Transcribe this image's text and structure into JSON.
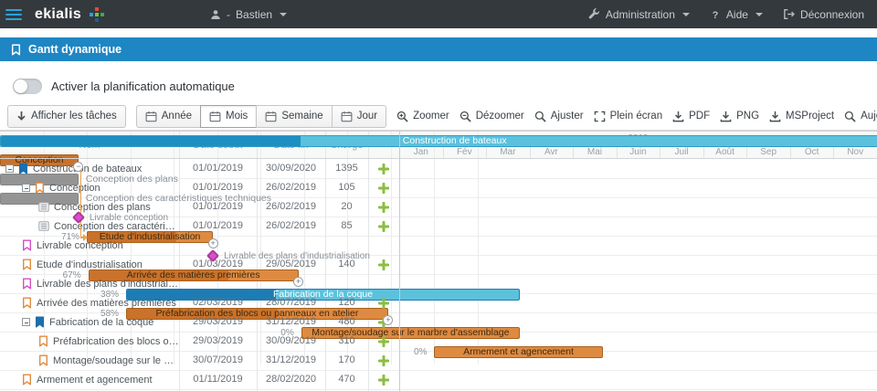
{
  "topbar": {
    "brand": "ekialis",
    "user_separator": "-",
    "user": "Bastien",
    "admin_label": "Administration",
    "help_label": "Aide",
    "logout_label": "Déconnexion"
  },
  "pageheader": {
    "title": "Gantt dynamique"
  },
  "controls": {
    "toggle_label": "Activer la planification automatique",
    "toggle_on": false
  },
  "toolbar": {
    "tasks_button": {
      "label": "Afficher les tâches",
      "icon": "down-arrow-icon"
    },
    "view_buttons": [
      {
        "label": "Année",
        "icon": "calendar-icon",
        "active": false
      },
      {
        "label": "Mois",
        "icon": "calendar-icon",
        "active": true
      },
      {
        "label": "Semaine",
        "icon": "calendar-icon",
        "active": false
      },
      {
        "label": "Jour",
        "icon": "calendar-icon",
        "active": false
      }
    ],
    "action_buttons": [
      {
        "label": "Zoomer",
        "icon": "zoom-in-icon"
      },
      {
        "label": "Dézoomer",
        "icon": "zoom-out-icon"
      },
      {
        "label": "Ajuster",
        "icon": "search-icon"
      },
      {
        "label": "Plein écran",
        "icon": "fullscreen-icon"
      },
      {
        "label": "PDF",
        "icon": "download-icon"
      },
      {
        "label": "PNG",
        "icon": "download-icon"
      },
      {
        "label": "MSProject",
        "icon": "download-icon"
      },
      {
        "label": "Aujourd'hui",
        "icon": "search-icon"
      }
    ]
  },
  "table": {
    "columns": [
      "Nom",
      "Date début",
      "Date fin",
      "Charge"
    ]
  },
  "timeline": {
    "year": "2019",
    "months": [
      "Jan",
      "Fév",
      "Mar",
      "Avr",
      "Mai",
      "Juin",
      "Juil",
      "Août",
      "Sep",
      "Oct",
      "Nov"
    ]
  },
  "colors": {
    "header_blue": "#1E86C3",
    "bar_orange": "#DE8A41",
    "bar_orange_dark": "#C9722B",
    "bar_teal": "#5BC1DD",
    "bar_teal_dark": "#1E8FC2",
    "bar_blue_dark": "#1D7CB4",
    "bar_gray": "#A7A7A7",
    "bar_gray_dark": "#949494",
    "milestone_pink": "#D94FC9",
    "add_green": "#8CBE41"
  },
  "connectors": [
    {
      "from": 1,
      "to": 5
    }
  ],
  "rows": [
    {
      "name": "Construction de bateaux",
      "date_debut": "01/01/2019",
      "date_fin": "30/09/2020",
      "charge": "1395",
      "indent": 0,
      "expander": true,
      "icon": "bookmark-blue-icon",
      "add_button": true,
      "bar": {
        "kind": "task",
        "from": "01/01/2019",
        "to": "30/09/2020",
        "palette": "teal",
        "progress": 0.33,
        "label": "Construction de bateaux",
        "label_pos": "inside"
      }
    },
    {
      "name": "Conception",
      "date_debut": "01/01/2019",
      "date_fin": "26/02/2019",
      "charge": "105",
      "indent": 1,
      "expander": true,
      "icon": "bookmark-orange-icon",
      "add_button": true,
      "bar": {
        "kind": "task",
        "from": "01/01/2019",
        "to": "26/02/2019",
        "palette": "orange",
        "progress": 1,
        "label": "Conception",
        "label_pos": "inside",
        "handle": "minus"
      }
    },
    {
      "name": "Conception des plans",
      "date_debut": "01/01/2019",
      "date_fin": "26/02/2019",
      "charge": "20",
      "indent": 2,
      "expander": false,
      "icon": "list-icon",
      "add_button": true,
      "bar": {
        "kind": "task",
        "from": "01/01/2019",
        "to": "26/02/2019",
        "palette": "gray",
        "progress": 1,
        "label": "Conception des plans",
        "label_pos": "right"
      }
    },
    {
      "name": "Conception des caractéristiques techniques",
      "date_debut": "01/01/2019",
      "date_fin": "26/02/2019",
      "charge": "85",
      "indent": 2,
      "expander": false,
      "icon": "list-icon",
      "add_button": true,
      "bar": {
        "kind": "task",
        "from": "01/01/2019",
        "to": "26/02/2019",
        "palette": "gray",
        "progress": 1,
        "label": "Conception des caractéristiques techniques",
        "label_pos": "right"
      }
    },
    {
      "name": "Livrable conception",
      "date_debut": "",
      "date_fin": "",
      "charge": "",
      "indent": 1,
      "expander": false,
      "icon": "bookmark-pink-icon",
      "add_button": false,
      "bar": {
        "kind": "milestone",
        "at": "26/02/2019",
        "label": "Livrable conception"
      }
    },
    {
      "name": "Etude d'industrialisation",
      "date_debut": "01/03/2019",
      "date_fin": "29/05/2019",
      "charge": "140",
      "indent": 1,
      "expander": false,
      "icon": "bookmark-orange-icon",
      "add_button": true,
      "bar": {
        "kind": "task",
        "from": "01/03/2019",
        "to": "29/05/2019",
        "palette": "orange",
        "progress": 0.71,
        "percent": "71%",
        "label": "Etude d'industrialisation",
        "label_pos": "inside",
        "handle": "plus"
      }
    },
    {
      "name": "Livrable des plans d'industrialisation",
      "date_debut": "",
      "date_fin": "",
      "charge": "",
      "indent": 1,
      "expander": false,
      "icon": "bookmark-pink-icon",
      "add_button": false,
      "bar": {
        "kind": "milestone",
        "at": "29/05/2019",
        "label": "Livrable des plans d'industrialisation"
      }
    },
    {
      "name": "Arrivée des matières premières",
      "date_debut": "02/03/2019",
      "date_fin": "28/07/2019",
      "charge": "120",
      "indent": 1,
      "expander": false,
      "icon": "bookmark-orange-icon",
      "add_button": true,
      "bar": {
        "kind": "task",
        "from": "02/03/2019",
        "to": "28/07/2019",
        "palette": "orange",
        "progress": 0.67,
        "percent": "67%",
        "label": "Arrivée des matières premières",
        "label_pos": "inside",
        "handle": "plus"
      }
    },
    {
      "name": "Fabrication de la coque",
      "date_debut": "29/03/2019",
      "date_fin": "31/12/2019",
      "charge": "480",
      "indent": 1,
      "expander": true,
      "icon": "bookmark-blue-icon",
      "add_button": true,
      "bar": {
        "kind": "task",
        "from": "29/03/2019",
        "to": "31/12/2019",
        "palette": "blue",
        "progress": 0.38,
        "percent": "38%",
        "label": "Fabrication de la coque",
        "label_pos": "inside"
      }
    },
    {
      "name": "Préfabrication des blocs ou panneaux en atelier",
      "date_debut": "29/03/2019",
      "date_fin": "30/09/2019",
      "charge": "310",
      "indent": 2,
      "expander": false,
      "icon": "bookmark-orange-icon",
      "add_button": true,
      "bar": {
        "kind": "task",
        "from": "29/03/2019",
        "to": "30/09/2019",
        "palette": "orange",
        "progress": 0.58,
        "percent": "58%",
        "label": "Préfabrication des blocs ou panneaux en atelier",
        "label_pos": "inside",
        "handle": "plus"
      }
    },
    {
      "name": "Montage/soudage sur le marbre d'assemblage",
      "date_debut": "30/07/2019",
      "date_fin": "31/12/2019",
      "charge": "170",
      "indent": 2,
      "expander": false,
      "icon": "bookmark-orange-icon",
      "add_button": true,
      "bar": {
        "kind": "task",
        "from": "30/07/2019",
        "to": "31/12/2019",
        "palette": "orange",
        "progress": 0,
        "percent": "0%",
        "label": "Montage/soudage sur le marbre d'assemblage",
        "label_pos": "inside"
      }
    },
    {
      "name": "Armement et agencement",
      "date_debut": "01/11/2019",
      "date_fin": "28/02/2020",
      "charge": "470",
      "indent": 1,
      "expander": false,
      "icon": "bookmark-orange-icon",
      "add_button": true,
      "bar": {
        "kind": "task",
        "from": "01/11/2019",
        "to": "28/02/2020",
        "palette": "orange",
        "progress": 0,
        "percent": "0%",
        "label": "Armement et agencement",
        "label_pos": "inside"
      }
    }
  ]
}
